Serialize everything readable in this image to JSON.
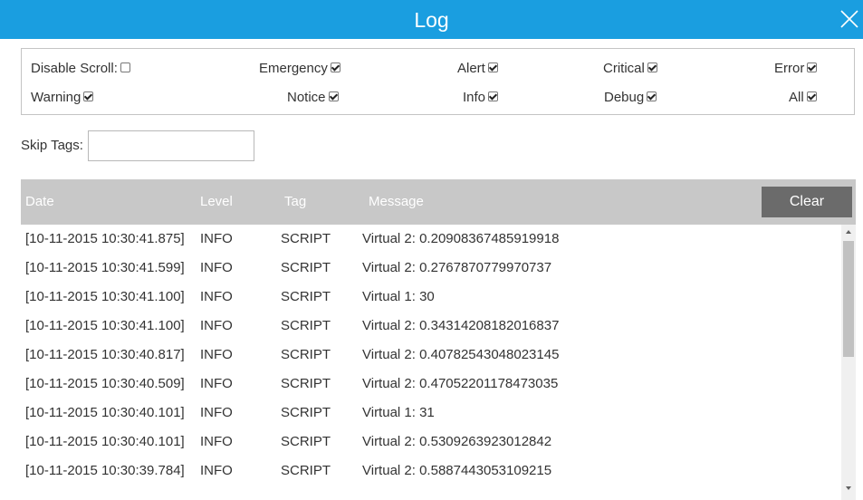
{
  "window": {
    "title": "Log"
  },
  "filters": [
    {
      "label": "Disable Scroll:",
      "checked": false
    },
    {
      "label": "Emergency",
      "checked": true
    },
    {
      "label": "Alert",
      "checked": true
    },
    {
      "label": "Critical",
      "checked": true
    },
    {
      "label": "Error",
      "checked": true
    },
    {
      "label": "Warning",
      "checked": true
    },
    {
      "label": "Notice",
      "checked": true
    },
    {
      "label": "Info",
      "checked": true
    },
    {
      "label": "Debug",
      "checked": true
    },
    {
      "label": "All",
      "checked": true
    }
  ],
  "skip_tags": {
    "label": "Skip Tags:",
    "value": ""
  },
  "table": {
    "columns": [
      "Date",
      "Level",
      "Tag",
      "Message"
    ],
    "clear_label": "Clear",
    "rows": [
      {
        "date": "[10-11-2015 10:30:41.875]",
        "level": "INFO",
        "tag": "SCRIPT",
        "message": "Virtual 2: 0.20908367485919918"
      },
      {
        "date": "[10-11-2015 10:30:41.599]",
        "level": "INFO",
        "tag": "SCRIPT",
        "message": "Virtual 2: 0.2767870779970737"
      },
      {
        "date": "[10-11-2015 10:30:41.100]",
        "level": "INFO",
        "tag": "SCRIPT",
        "message": "Virtual 1: 30"
      },
      {
        "date": "[10-11-2015 10:30:41.100]",
        "level": "INFO",
        "tag": "SCRIPT",
        "message": "Virtual 2: 0.34314208182016837"
      },
      {
        "date": "[10-11-2015 10:30:40.817]",
        "level": "INFO",
        "tag": "SCRIPT",
        "message": "Virtual 2: 0.40782543048023145"
      },
      {
        "date": "[10-11-2015 10:30:40.509]",
        "level": "INFO",
        "tag": "SCRIPT",
        "message": "Virtual 2: 0.47052201178473035"
      },
      {
        "date": "[10-11-2015 10:30:40.101]",
        "level": "INFO",
        "tag": "SCRIPT",
        "message": "Virtual 1: 31"
      },
      {
        "date": "[10-11-2015 10:30:40.101]",
        "level": "INFO",
        "tag": "SCRIPT",
        "message": "Virtual 2: 0.5309263923012842"
      },
      {
        "date": "[10-11-2015 10:30:39.784]",
        "level": "INFO",
        "tag": "SCRIPT",
        "message": "Virtual 2: 0.5887443053109215"
      }
    ]
  },
  "icons": {
    "close": "close-icon",
    "scroll_up": "arrow-up-icon",
    "scroll_down": "arrow-down-icon"
  },
  "colors": {
    "titlebar": "#1a9ee0",
    "header": "#c8c8c8",
    "clear_button": "#6b6b6b"
  }
}
